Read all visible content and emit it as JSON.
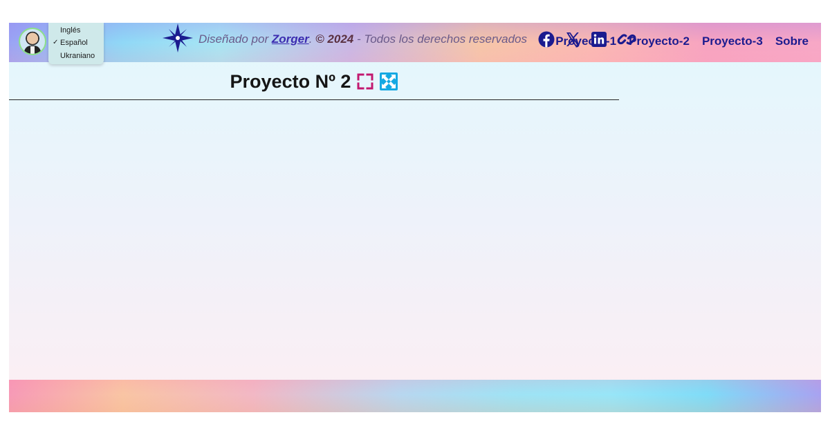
{
  "header": {
    "languages": [
      {
        "label": "Inglés",
        "selected": false
      },
      {
        "label": "Español",
        "selected": true
      },
      {
        "label": "Ukraniano",
        "selected": false
      }
    ],
    "selected_mark": "✓",
    "nav": [
      "Proyecto-1",
      "Proyecto-2",
      "Proyecto-3",
      "Sobre"
    ]
  },
  "main": {
    "title": "Proyecto Nº 2",
    "icons": [
      "fullscreen-icon",
      "expand-arrows-icon"
    ]
  },
  "footer": {
    "designed_by": "Diseñado por",
    "author": "Zorger",
    "period": ".",
    "copyright": "© 2024",
    "rights": "- Todos los derechos reservados",
    "logo_icon": "compass-star-icon",
    "social": [
      "facebook-icon",
      "x-twitter-icon",
      "linkedin-icon",
      "link-icon"
    ]
  },
  "colors": {
    "nav_text": "#1b1b8f",
    "fullscreen_icon": "#c2186f",
    "expand_icon": "#15a9e3",
    "social_icons": "#1b1b8f"
  }
}
